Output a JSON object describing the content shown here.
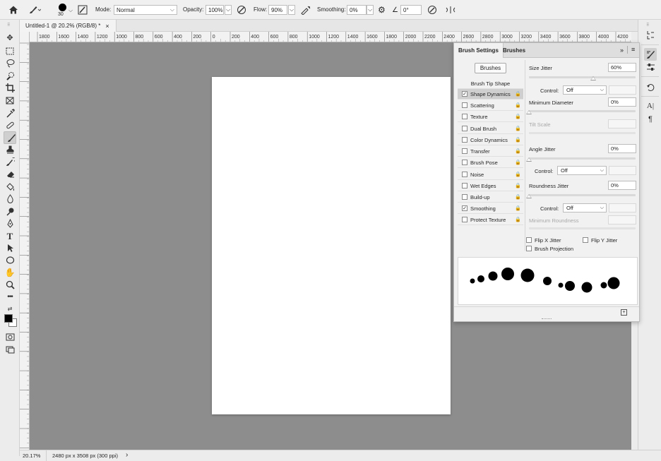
{
  "options_bar": {
    "brush_size": "30",
    "mode_label": "Mode:",
    "mode_value": "Normal",
    "opacity_label": "Opacity:",
    "opacity_value": "100%",
    "flow_label": "Flow:",
    "flow_value": "90%",
    "smoothing_label": "Smoothing:",
    "smoothing_value": "0%",
    "angle_value": "0°"
  },
  "document": {
    "tab_title": "Untitled-1 @ 20.2% (RGB/8) *",
    "close_glyph": "×"
  },
  "rulers": {
    "horizontal": [
      "1800",
      "1600",
      "1400",
      "1200",
      "1000",
      "800",
      "600",
      "400",
      "200",
      "0",
      "200",
      "400",
      "600",
      "800",
      "1000",
      "1200",
      "1400",
      "1600",
      "1800",
      "2000",
      "2200",
      "2400",
      "2600",
      "2800",
      "3000",
      "3200",
      "3400",
      "3600",
      "3800",
      "4000",
      "4200"
    ]
  },
  "status": {
    "zoom": "20.17%",
    "doc_info": "2480 px x 3508 px (300 ppi)",
    "arrow": "›"
  },
  "panel": {
    "tabs": [
      "Brush Settings",
      "Brushes"
    ],
    "brushes_button": "Brushes",
    "brush_tip_shape": "Brush Tip Shape",
    "items": [
      {
        "label": "Shape Dynamics",
        "checked": true,
        "selected": true
      },
      {
        "label": "Scattering",
        "checked": false
      },
      {
        "label": "Texture",
        "checked": false
      },
      {
        "label": "Dual Brush",
        "checked": false
      },
      {
        "label": "Color Dynamics",
        "checked": false
      },
      {
        "label": "Transfer",
        "checked": false
      },
      {
        "label": "Brush Pose",
        "checked": false
      },
      {
        "label": "Noise",
        "checked": false
      },
      {
        "label": "Wet Edges",
        "checked": false
      },
      {
        "label": "Build-up",
        "checked": false
      },
      {
        "label": "Smoothing",
        "checked": true
      },
      {
        "label": "Protect Texture",
        "checked": false
      }
    ],
    "size_jitter_label": "Size Jitter",
    "size_jitter_value": "60%",
    "control_label": "Control:",
    "control1_value": "Off",
    "min_diameter_label": "Minimum Diameter",
    "min_diameter_value": "0%",
    "tilt_scale_label": "Tilt Scale",
    "angle_jitter_label": "Angle Jitter",
    "angle_jitter_value": "0%",
    "control2_value": "Off",
    "roundness_jitter_label": "Roundness Jitter",
    "roundness_jitter_value": "0%",
    "control3_value": "Off",
    "min_roundness_label": "Minimum Roundness",
    "flip_x_label": "Flip X Jitter",
    "flip_y_label": "Flip Y Jitter",
    "brush_projection_label": "Brush Projection",
    "size_jitter_fraction": 0.6,
    "collapse_glyph": "»",
    "menu_glyph": "≡",
    "lock_glyph": "🔒"
  },
  "colors": {
    "canvas_bg": "#8d8d8d",
    "foreground": "#000000",
    "background": "#ffffff"
  },
  "icons": [
    "home-icon",
    "brush-icon",
    "move-icon",
    "marquee-icon",
    "lasso-icon",
    "quick-select-icon",
    "crop-icon",
    "frame-icon",
    "eyedropper-icon",
    "healing-icon",
    "brush-tool-icon",
    "stamp-icon",
    "history-brush-icon",
    "eraser-icon",
    "paint-bucket-icon",
    "blur-icon",
    "dodge-icon",
    "pen-icon",
    "type-icon",
    "path-select-icon",
    "ellipse-icon",
    "hand-icon",
    "zoom-icon",
    "more-icon"
  ]
}
